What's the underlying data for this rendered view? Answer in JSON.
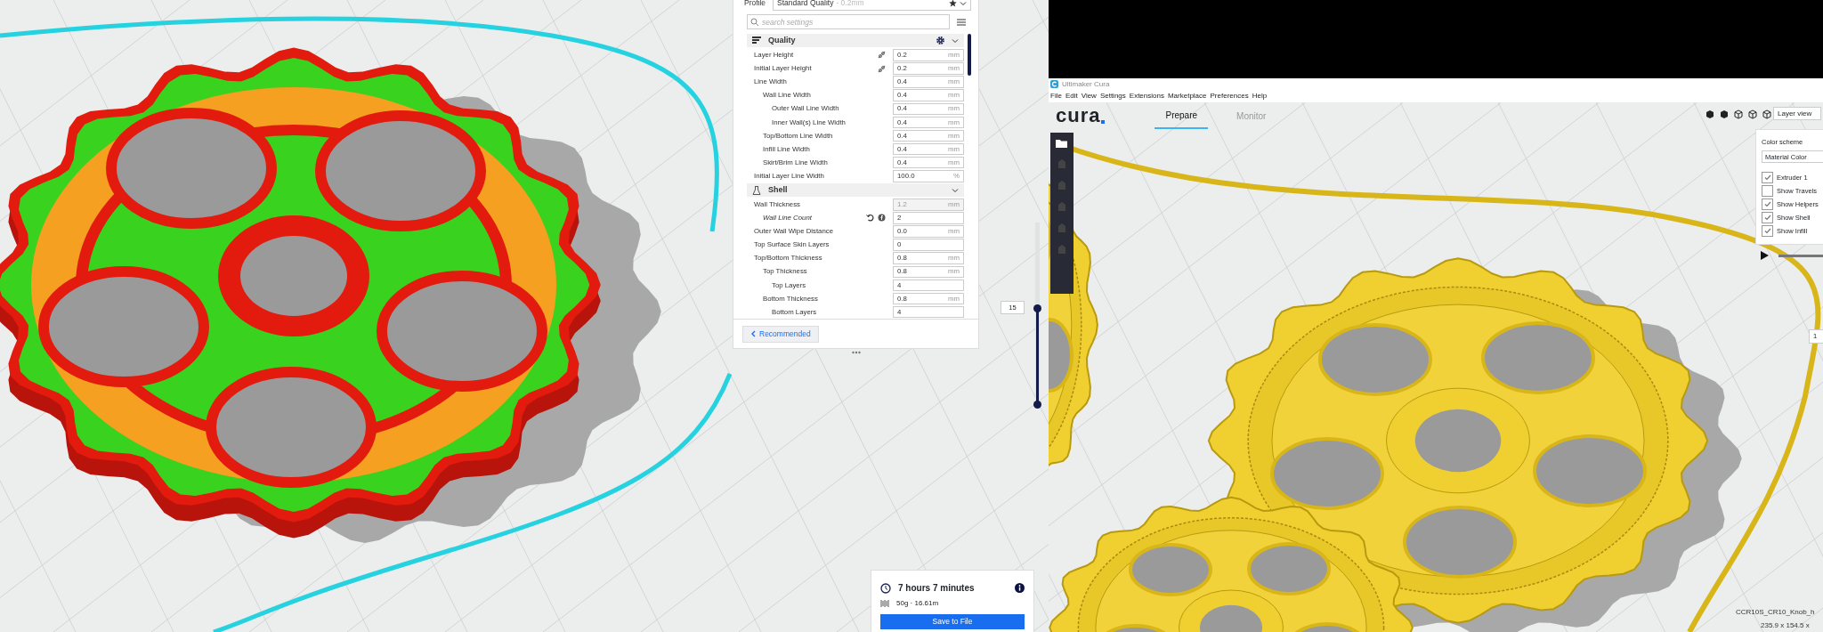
{
  "left_view": {
    "settings_panel": {
      "profile_label": "Profile",
      "profile_value": "Standard Quality",
      "profile_hint": " - 0.2mm",
      "search": {
        "placeholder": "search settings"
      },
      "categories": [
        {
          "kind": "quality",
          "title": "Quality",
          "gear_shown": true,
          "settings": [
            {
              "label": "Layer Height",
              "value": "0.2",
              "unit": "mm",
              "linked": true
            },
            {
              "label": "Initial Layer Height",
              "value": "0.2",
              "unit": "mm",
              "linked": true
            },
            {
              "label": "Line Width",
              "value": "0.4",
              "unit": "mm",
              "children": [
                {
                  "label": "Wall Line Width",
                  "value": "0.4",
                  "unit": "mm",
                  "children": [
                    {
                      "label": "Outer Wall Line Width",
                      "value": "0.4",
                      "unit": "mm"
                    },
                    {
                      "label": "Inner Wall(s) Line Width",
                      "value": "0.4",
                      "unit": "mm"
                    }
                  ]
                },
                {
                  "label": "Top/Bottom Line Width",
                  "value": "0.4",
                  "unit": "mm"
                },
                {
                  "label": "Infill Line Width",
                  "value": "0.4",
                  "unit": "mm"
                },
                {
                  "label": "Skirt/Brim Line Width",
                  "value": "0.4",
                  "unit": "mm"
                }
              ]
            },
            {
              "label": "Initial Layer Line Width",
              "value": "100.0",
              "unit": "%"
            }
          ]
        },
        {
          "kind": "shell",
          "title": "Shell",
          "gear_shown": false,
          "settings": [
            {
              "label": "Wall Thickness",
              "value": "1.2",
              "unit": "mm",
              "disabled": true,
              "children": [
                {
                  "label": "Wall Line Count",
                  "value": "2",
                  "overridden": true
                }
              ]
            },
            {
              "label": "Outer Wall Wipe Distance",
              "value": "0.0",
              "unit": "mm"
            },
            {
              "label": "Top Surface Skin Layers",
              "value": "0"
            },
            {
              "label": "Top/Bottom Thickness",
              "value": "0.8",
              "unit": "mm",
              "children": [
                {
                  "label": "Top Thickness",
                  "value": "0.8",
                  "unit": "mm",
                  "children": [
                    {
                      "label": "Top Layers",
                      "value": "4"
                    }
                  ]
                },
                {
                  "label": "Bottom Thickness",
                  "value": "0.8",
                  "unit": "mm",
                  "children": [
                    {
                      "label": "Bottom Layers",
                      "value": "4"
                    }
                  ]
                }
              ]
            }
          ]
        }
      ],
      "recommended_button": "Recommended"
    },
    "layer_slider": {
      "label": "15",
      "level": 0.53
    },
    "print_info": {
      "time": "7 hours 7 minutes",
      "material": "50g · 16.61m",
      "save_button": "Save to File"
    }
  },
  "right_window": {
    "title": "Ultimaker Cura",
    "menu": [
      "File",
      "Edit",
      "View",
      "Settings",
      "Extensions",
      "Marketplace",
      "Preferences",
      "Help"
    ],
    "logo": "cura",
    "stages": [
      {
        "label": "Prepare",
        "selected": true
      },
      {
        "label": "Monitor",
        "selected": false
      }
    ],
    "view_select": "Layer view",
    "color_scheme": {
      "label": "Color scheme",
      "value": "Material Color",
      "options": [
        {
          "label": "Extruder 1",
          "checked": true
        },
        {
          "label": "Show Travels",
          "checked": false
        },
        {
          "label": "Show Helpers",
          "checked": true
        },
        {
          "label": "Show Shell",
          "checked": true
        },
        {
          "label": "Show Infill",
          "checked": true
        }
      ]
    },
    "layer_field": "1",
    "object_name": "CCR10S_CR10_Knob_h",
    "dimensions": "235.9 x 154.5 x"
  }
}
